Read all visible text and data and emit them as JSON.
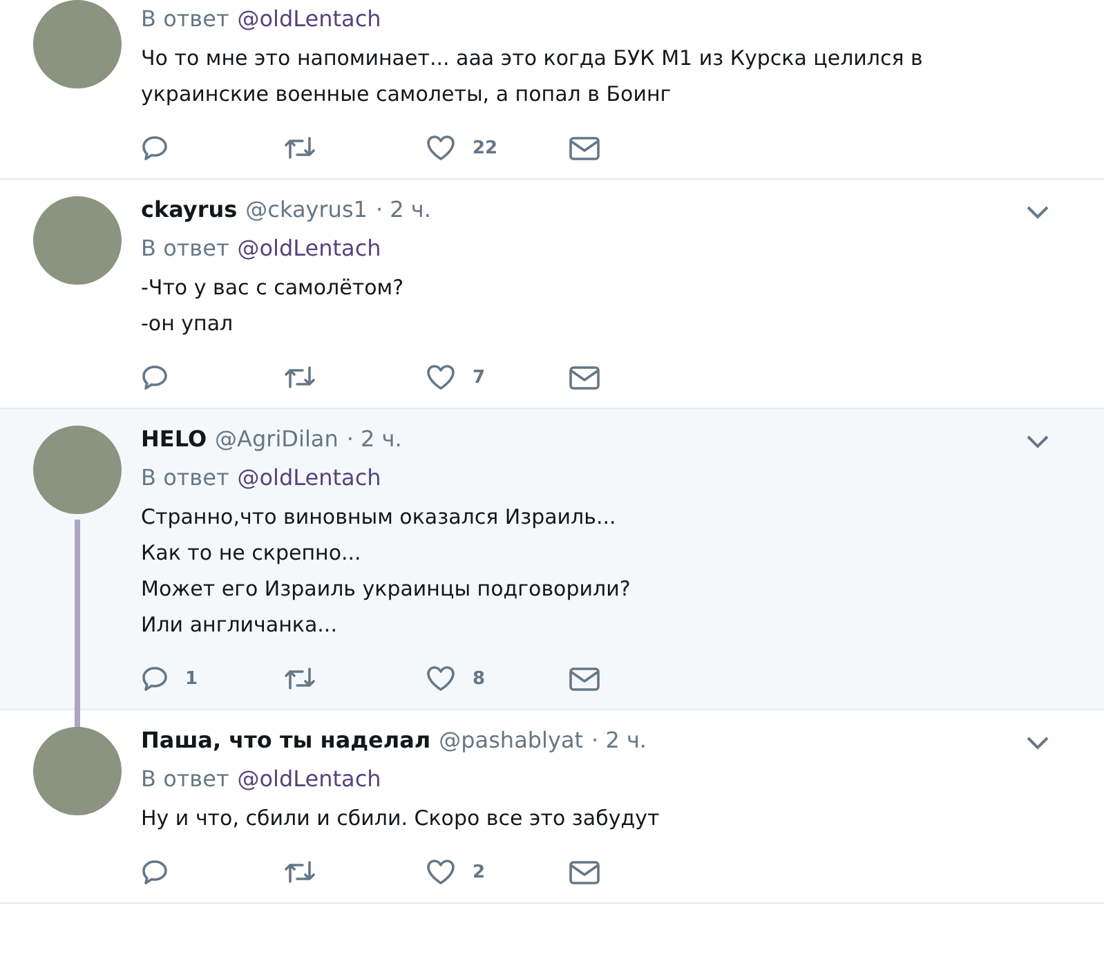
{
  "tweets": [
    {
      "reply_label": "В ответ",
      "reply_to": "@oldLentach",
      "lines": [
        "Чо то мне это напоминает... ааа это когда БУК М1 из Курска целился в",
        "украинские военные самолеты, а попал в Боинг"
      ],
      "likes": "22",
      "highlighted": false,
      "thread_line": false
    },
    {
      "name": "ckayrus",
      "handle": "@ckayrus1",
      "time": "· 2 ч.",
      "reply_label": "В ответ",
      "reply_to": "@oldLentach",
      "lines": [
        "-Что у вас с самолётом?",
        "-он упал"
      ],
      "likes": "7",
      "highlighted": false,
      "thread_line": false
    },
    {
      "name": "HELO",
      "handle": "@AgriDilan",
      "time": "· 2 ч.",
      "reply_label": "В ответ",
      "reply_to": "@oldLentach",
      "lines": [
        "Странно,что виновным оказался Израиль...",
        "Как то не скрепно...",
        "Может его Израиль украинцы подговорили?",
        "Или англичанка..."
      ],
      "replies": "1",
      "likes": "8",
      "highlighted": true,
      "thread_line": true
    },
    {
      "name": "Паша, что ты наделал",
      "handle": "@pashablyat",
      "time": "· 2 ч.",
      "reply_label": "В ответ",
      "reply_to": "@oldLentach",
      "lines": [
        "Ну и что, сбили и сбили. Скоро все это забудут"
      ],
      "likes": "2",
      "highlighted": false,
      "thread_line": false
    }
  ]
}
